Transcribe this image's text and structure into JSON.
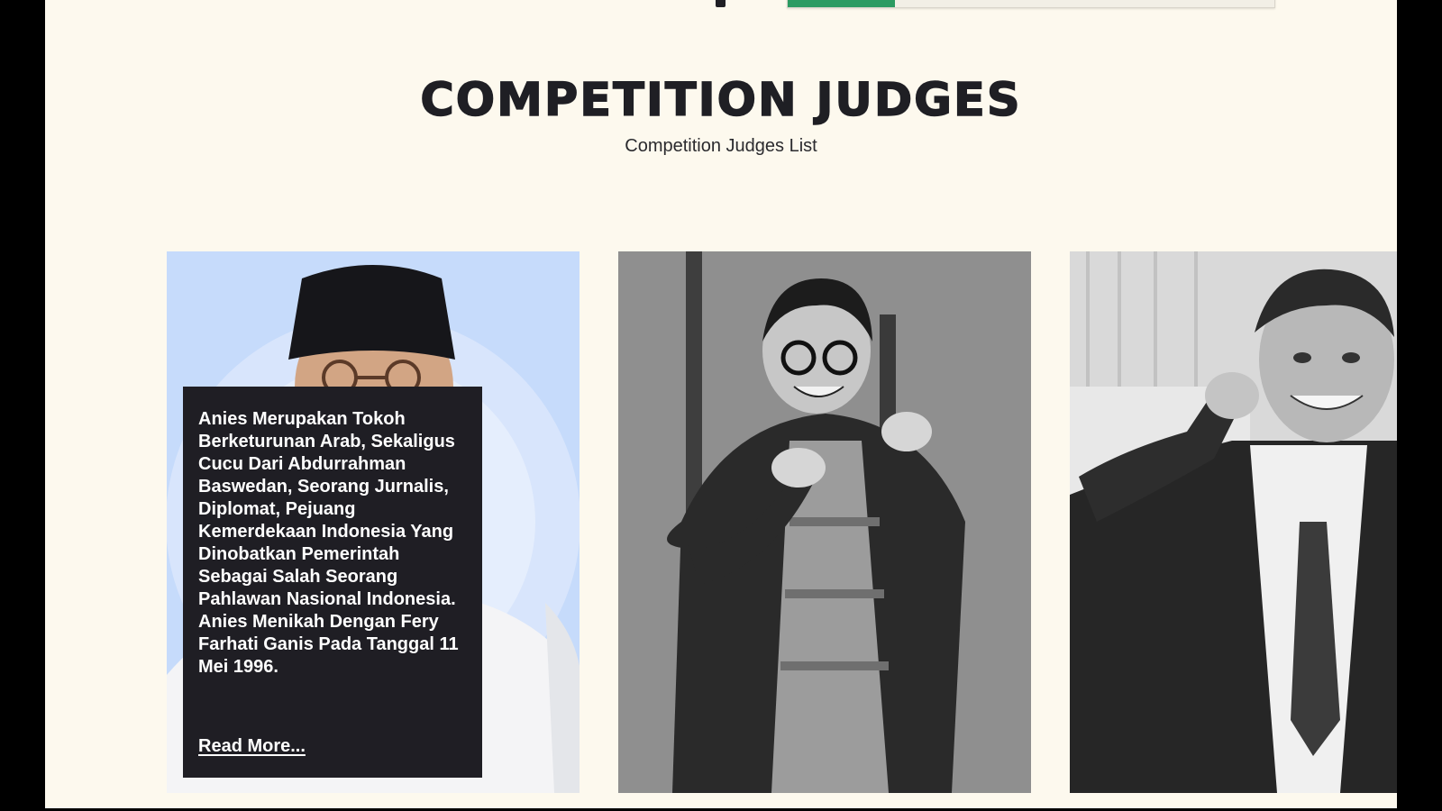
{
  "progress": {
    "fraction": 0.22,
    "accent_color": "#2b9b62"
  },
  "section": {
    "title": "COMPETITION JUDGES",
    "subtitle": "Competition Judges List"
  },
  "judges": [
    {
      "description": "Anies Merupakan Tokoh Berketurunan Arab, Sekaligus Cucu Dari Abdurrahman Baswedan, Seorang Jurnalis, Diplomat, Pejuang Kemerdekaan Indonesia Yang Dinobatkan Pemerintah Sebagai Salah Seorang Pahlawan Nasional Indonesia. Anies Menikah Dengan Fery Farhati Ganis Pada Tanggal 11 Mei 1996.",
      "read_more_label": "Read More..."
    },
    {},
    {}
  ],
  "colors": {
    "page_background": "#fdf9ee",
    "overlay_background": "#1f1e24",
    "title_color": "#1f1f24"
  }
}
